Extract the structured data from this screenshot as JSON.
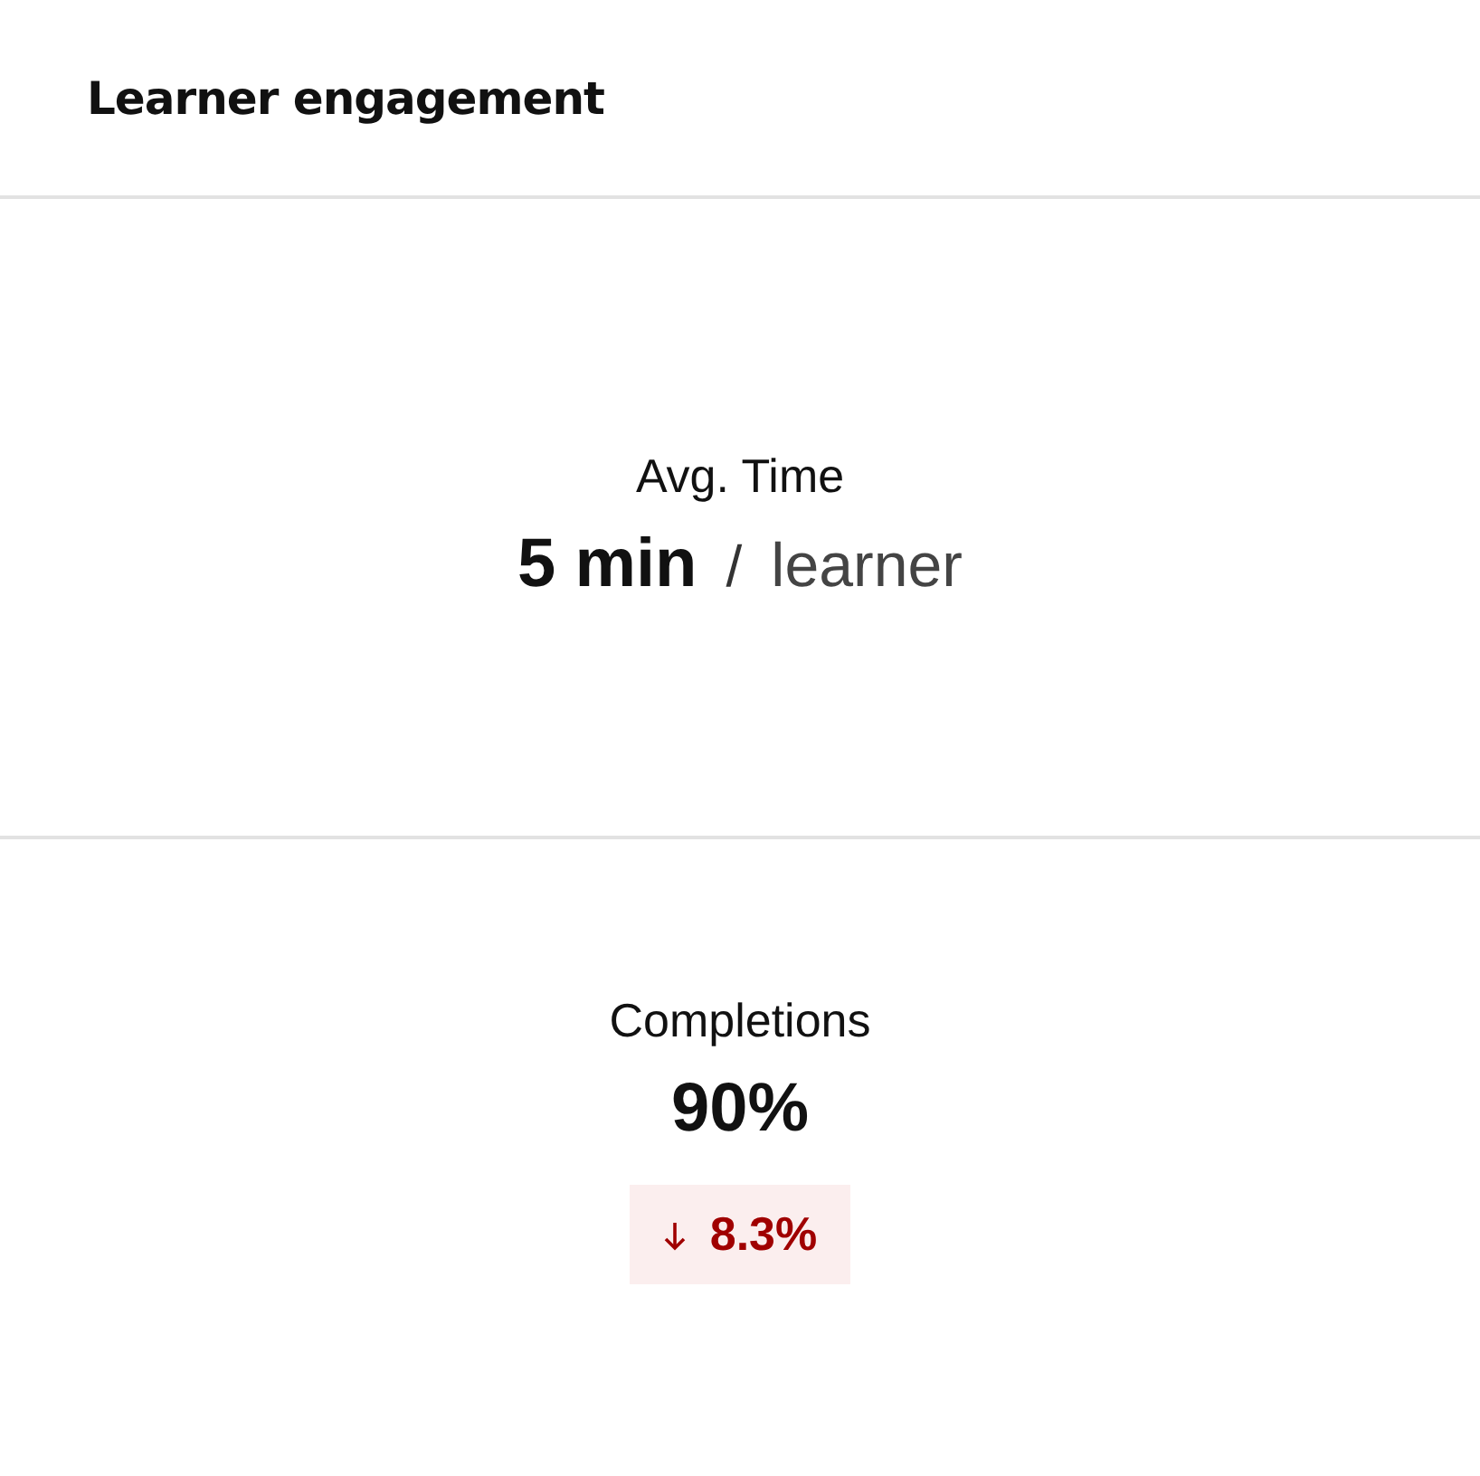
{
  "card": {
    "title": "Learner engagement"
  },
  "metrics": [
    {
      "label": "Avg. Time",
      "value": "5 min",
      "separator": "/",
      "unit": "learner"
    },
    {
      "label": "Completions",
      "value": "90%",
      "trend": {
        "down": true,
        "text": "8.3%"
      }
    }
  ]
}
